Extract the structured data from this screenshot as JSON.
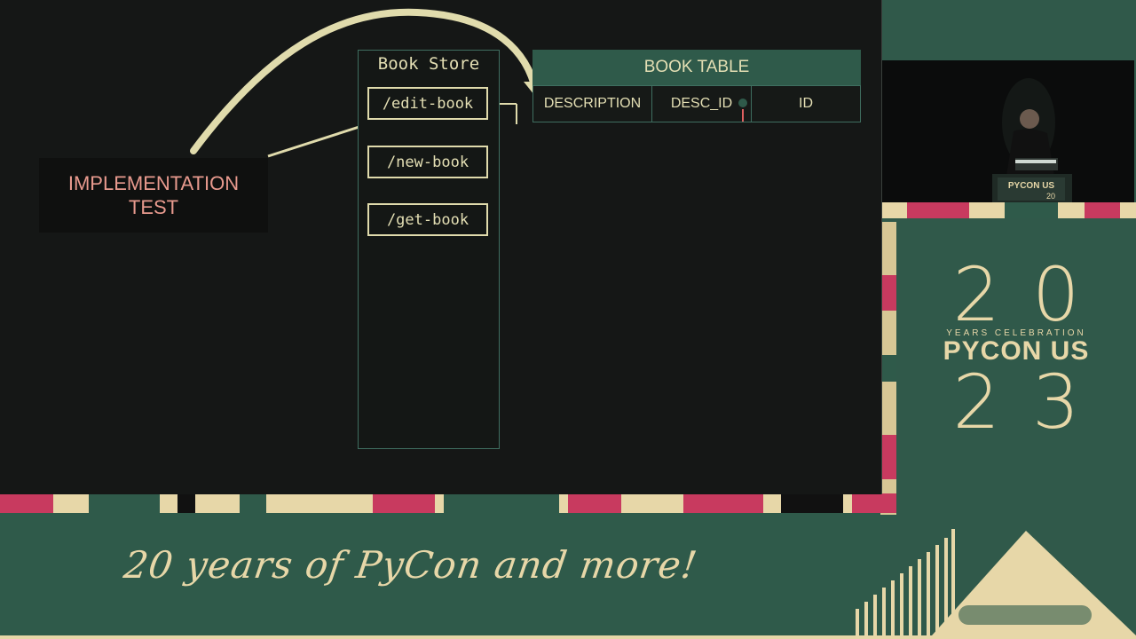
{
  "slide": {
    "implementation_label_line1": "IMPLEMENTATION",
    "implementation_label_line2": "TEST",
    "store_title": "Book Store",
    "routes": [
      "/edit-book",
      "/new-book",
      "/get-book"
    ],
    "table_title": "BOOK TABLE",
    "columns": [
      "DESCRIPTION",
      "DESC_ID",
      "ID"
    ]
  },
  "banner": {
    "tagline": "20 years of PyCon and more!"
  },
  "logo": {
    "top_number": "20",
    "subtitle": "YEARS CELEBRATION",
    "name": "PYCON US",
    "bottom_number": "23"
  },
  "camera": {
    "podium_text": "PYCON US",
    "podium_number": "20"
  },
  "colors": {
    "green": "#2f5a4a",
    "cream": "#e7d7a8",
    "pink": "#c83a5f",
    "slide_bg": "#151716",
    "salmon_text": "#e89a8e"
  }
}
